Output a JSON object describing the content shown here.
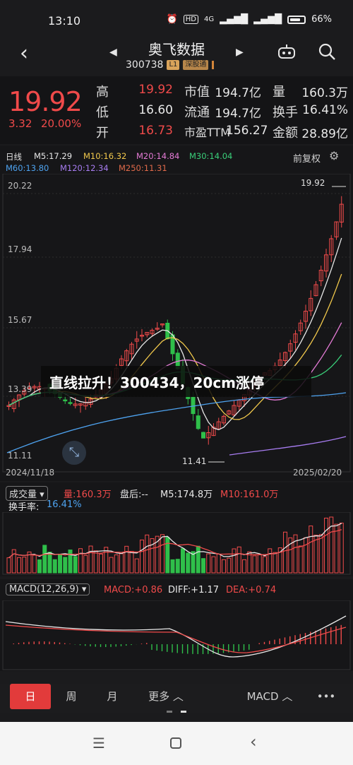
{
  "status": {
    "time": "13:10",
    "network": "4G",
    "battery": "66%"
  },
  "header": {
    "stock_name": "奥飞数据",
    "stock_code": "300738",
    "badge_level": "L1",
    "badge_connect": "深股通"
  },
  "quote": {
    "price": "19.92",
    "change": "3.32",
    "change_pct": "20.00%",
    "rows": [
      {
        "l1": "高",
        "v1": "19.92",
        "l2": "市值",
        "v2": "194.7亿",
        "l3": "量",
        "v3": "160.3万"
      },
      {
        "l1": "低",
        "v1": "16.60",
        "l2": "流通",
        "v2": "194.7亿",
        "l3": "换手",
        "v3": "16.41%"
      },
      {
        "l1": "开",
        "v1": "16.73",
        "l2": "市盈TTM",
        "v2": "156.27",
        "l3": "金额",
        "v3": "28.89亿"
      }
    ]
  },
  "kline": {
    "period_label": "日线",
    "ma": [
      {
        "text": "M5:17.29",
        "color": "#e8e8e8"
      },
      {
        "text": "M10:16.32",
        "color": "#f2c94c"
      },
      {
        "text": "M20:14.84",
        "color": "#e57bd6"
      },
      {
        "text": "M30:14.04",
        "color": "#3ad07a"
      },
      {
        "text": "M60:13.80",
        "color": "#4ea3f0"
      },
      {
        "text": "M120:12.34",
        "color": "#a77cf0"
      },
      {
        "text": "M250:11.31",
        "color": "#e06a4a"
      }
    ],
    "adjust_label": "前复权",
    "y_ticks": [
      "20.22",
      "17.94",
      "15.67",
      "13.39",
      "11.11"
    ],
    "high_marker": "19.92",
    "low_marker": "11.41",
    "start_date": "2024/11/18",
    "end_date": "2025/02/20"
  },
  "headline": "直线拉升！300434，20cm涨停",
  "volume": {
    "selector": "成交量",
    "vol_text": "量:160.3万",
    "after_hours": "盘后:--",
    "m5_text": "M5:174.8万",
    "m10_text": "M10:161.0万",
    "turnover_label": "换手率:",
    "turnover_value": "16.41%"
  },
  "macd": {
    "selector": "MACD(12,26,9)",
    "macd_text": "MACD:+0.86",
    "diff_text": "DIFF:+1.17",
    "dea_text": "DEA:+0.74"
  },
  "toolbar": {
    "tabs": [
      "日",
      "周",
      "月"
    ],
    "more": "更多",
    "indicator": "MACD",
    "dots": "•••"
  },
  "colors": {
    "up": "#f04a4a",
    "down": "#2fbf4a",
    "accent": "#e23b3b"
  }
}
